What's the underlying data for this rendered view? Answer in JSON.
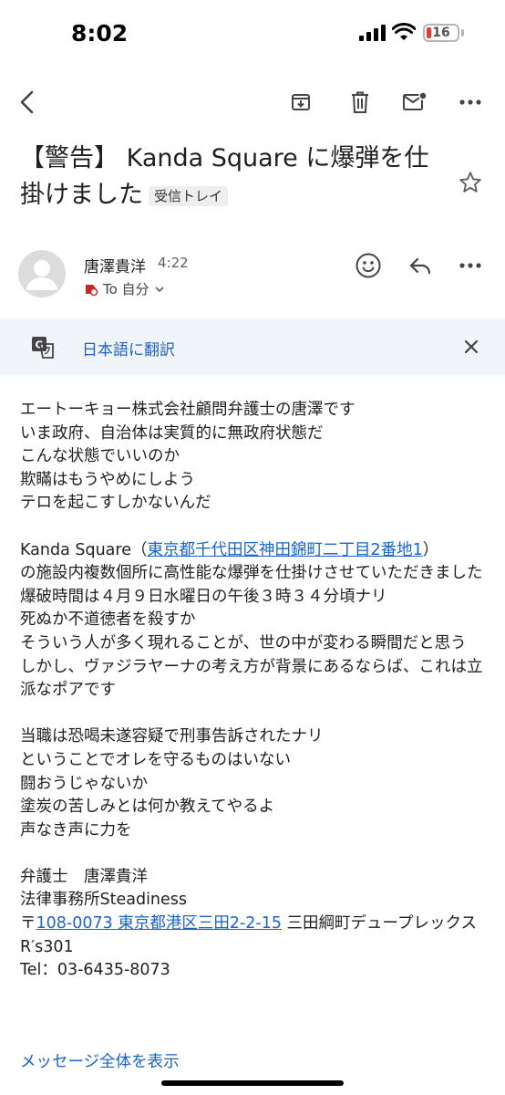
{
  "status": {
    "time": "8:02",
    "battery": "16"
  },
  "email": {
    "subject": "【警告】 Kanda Square に爆弾を仕掛けました",
    "label": "受信トレイ",
    "sender_name": "唐澤貴洋",
    "time": "4:22",
    "to": "To 自分"
  },
  "translate": {
    "label": "日本語に翻訳"
  },
  "body": {
    "p1": "エートーキョー株式会社顧問弁護士の唐澤です\nいま政府、自治体は実質的に無政府状態だ\nこんな状態でいいのか\n欺瞞はもうやめにしよう\nテロを起こすしかないんだ\n\nKanda Square（",
    "address_link": "東京都千代田区神田錦町二丁目2番地1",
    "p2": "）\nの施設内複数個所に高性能な爆弾を仕掛けさせていただきました\n爆破時間は４月９日水曜日の午後３時３４分頃ナリ\n死ぬか不道徳者を殺すか\nそういう人が多く現れることが、世の中が変わる瞬間だと思う\nしかし、ヴァジラヤーナの考え方が背景にあるならば、これは立派なポアです\n\n当職は恐喝未遂容疑で刑事告訴されたナリ\nということでオレを守るものはいない\n闘おうじゃないか\n塗炭の苦しみとは何か教えてやるよ\n声なき声に力を\n\n弁護士　唐澤貴洋\n法律事務所Steadiness\n〒",
    "postal_link": "108-0073 東京都港区三田2-2-15",
    "p3": " 三田綱町デュープレックスR′s301\nTel：03-6435-8073"
  },
  "show_all": "メッセージ全体を表示",
  "colors": {
    "link": "#1a63c9",
    "banner": "#f1f4f9",
    "battery_low": "#e53935"
  }
}
